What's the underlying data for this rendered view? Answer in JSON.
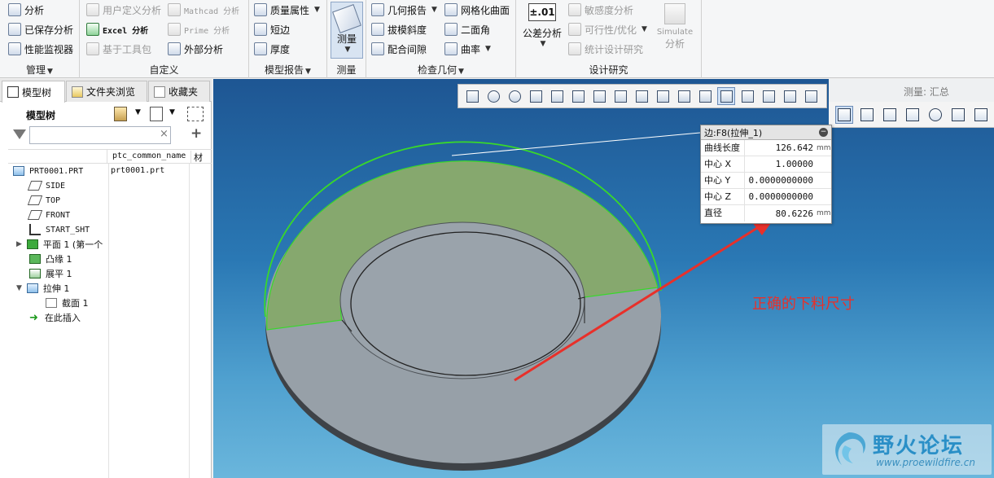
{
  "ribbon": {
    "manage": {
      "items": [
        "分析",
        "已保存分析",
        "性能监视器"
      ],
      "label": "管理"
    },
    "custom": {
      "items": [
        "用户定义分析",
        "Mathcad 分析",
        "Excel 分析",
        "Prime 分析",
        "基于工具包",
        "外部分析"
      ],
      "label": "自定义"
    },
    "model_report": {
      "items": [
        "质量属性",
        "短边",
        "厚度"
      ],
      "label": "模型报告"
    },
    "measure": {
      "button": "测量",
      "label": "测量"
    },
    "inspect_geometry": {
      "items": [
        "几何报告",
        "网格化曲面",
        "拔模斜度",
        "二面角",
        "配合间隙",
        "曲率"
      ],
      "label": "检查几何"
    },
    "design_study": {
      "tolerance_icon": "±.01",
      "tolerance_button": "公差分析",
      "items": [
        "敏感度分析",
        "可行性/优化",
        "统计设计研究"
      ],
      "simulate": [
        "Simulate",
        "分析"
      ],
      "label": "设计研究"
    }
  },
  "panel": {
    "tabs": [
      "模型树",
      "文件夹浏览",
      "收藏夹"
    ],
    "tree_title": "模型树",
    "search": {
      "value": "",
      "placeholder": ""
    },
    "columns": [
      "ptc_common_name",
      "材"
    ],
    "rows": [
      {
        "label": "PRT0001.PRT",
        "common_name": "prt0001.prt"
      },
      {
        "label": "SIDE"
      },
      {
        "label": "TOP"
      },
      {
        "label": "FRONT"
      },
      {
        "label": "START_SHT"
      },
      {
        "label": "平面 1 (第一个"
      },
      {
        "label": "凸缘 1"
      },
      {
        "label": "展平 1"
      },
      {
        "label": "拉伸 1"
      },
      {
        "label": "截面 1"
      },
      {
        "label": "在此插入"
      }
    ]
  },
  "viewport": {
    "measure_label": "测量: 汇总",
    "result": {
      "title": "边:F8(拉伸_1)",
      "rows": [
        {
          "label": "曲线长度",
          "value": "126.642",
          "unit": "mm"
        },
        {
          "label": "中心 X",
          "value": "1.00000",
          "unit": ""
        },
        {
          "label": "中心 Y",
          "value": "0.0000000000",
          "unit": ""
        },
        {
          "label": "中心 Z",
          "value": "0.0000000000",
          "unit": ""
        },
        {
          "label": "直径",
          "value": "80.6226",
          "unit": "mm"
        }
      ]
    },
    "annotation": "正确的下料尺寸",
    "watermark": {
      "title": "野火论坛",
      "url": "www.proewildfire.cn"
    }
  },
  "colors": {
    "annotation": "#e8302a",
    "highlight_face": "#86a86e",
    "part_gray": "#97a0a8",
    "edge_highlight": "#39d82a",
    "viewport_top": "#1e5693",
    "viewport_bottom": "#6ab6dc"
  }
}
